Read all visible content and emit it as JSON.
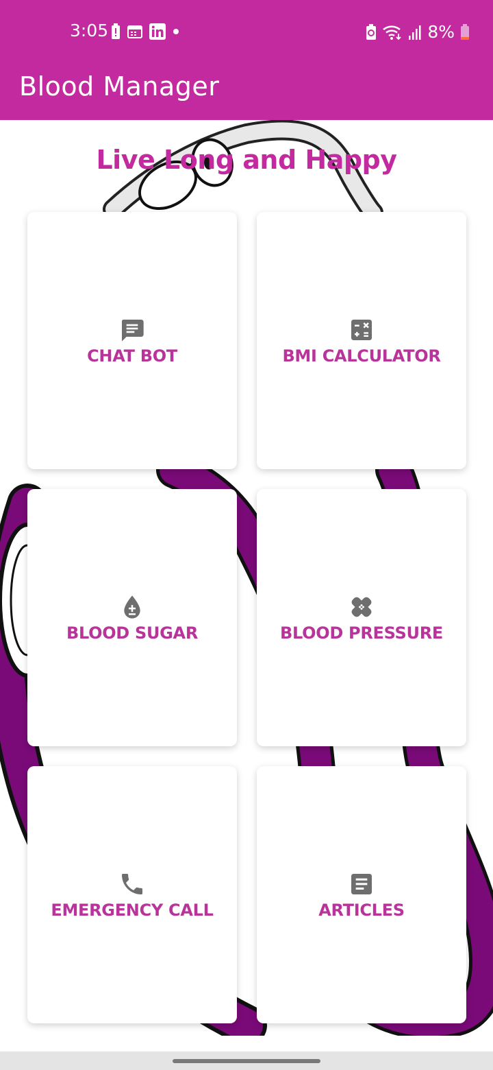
{
  "status_bar": {
    "time": "3:05",
    "battery_percent": "8%",
    "left_icons": [
      "battery-alert-icon",
      "calendar-icon",
      "linkedin-icon",
      "dot-icon"
    ],
    "right_icons": [
      "battery-saver-icon",
      "wifi-icon",
      "signal-icon",
      "battery-icon"
    ]
  },
  "app_bar": {
    "title": "Blood Manager"
  },
  "main": {
    "tagline": "Live Long and Happy",
    "cards": [
      {
        "label": "CHAT BOT",
        "icon": "chat-icon"
      },
      {
        "label": "BMI CALCULATOR",
        "icon": "calculator-icon"
      },
      {
        "label": "BLOOD SUGAR",
        "icon": "blood-drop-icon"
      },
      {
        "label": "BLOOD PRESSURE",
        "icon": "bandage-icon"
      },
      {
        "label": "EMERGENCY CALL",
        "icon": "phone-icon"
      },
      {
        "label": "ARTICLES",
        "icon": "article-icon"
      }
    ]
  },
  "colors": {
    "accent": "#c42a9f",
    "label": "#b8339a",
    "icon": "#6e6e6e",
    "stethoscope_tube": "#7a0a78"
  }
}
